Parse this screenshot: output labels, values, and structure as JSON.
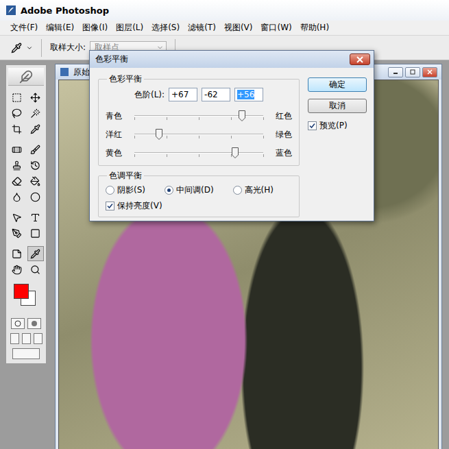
{
  "app": {
    "title": "Adobe Photoshop"
  },
  "menu": [
    "文件(F)",
    "编辑(E)",
    "图像(I)",
    "图层(L)",
    "选择(S)",
    "滤镜(T)",
    "视图(V)",
    "窗口(W)",
    "帮助(H)"
  ],
  "options_bar": {
    "label": "取样大小:",
    "value": "取样点"
  },
  "toolbox": {
    "foreground_color": "#ff0000",
    "background_color": "#ffffff"
  },
  "document": {
    "title": "原始"
  },
  "dialog": {
    "title": "色彩平衡",
    "balance_group": "色彩平衡",
    "levels_label": "色阶(L):",
    "levels": [
      {
        "value": "+67",
        "focused": false
      },
      {
        "value": "-62",
        "focused": false
      },
      {
        "value": "+56",
        "focused": true
      }
    ],
    "sliders": [
      {
        "left": "青色",
        "right": "红色",
        "level": 0.835
      },
      {
        "left": "洋红",
        "right": "绿色",
        "level": 0.19
      },
      {
        "left": "黄色",
        "right": "蓝色",
        "level": 0.78
      }
    ],
    "tone_group": "色调平衡",
    "tones": [
      {
        "label": "阴影(S)",
        "selected": false
      },
      {
        "label": "中间调(D)",
        "selected": true
      },
      {
        "label": "高光(H)",
        "selected": false
      }
    ],
    "preserve": {
      "label": "保持亮度(V)",
      "checked": true
    },
    "buttons": [
      {
        "label": "确定",
        "default": true
      },
      {
        "label": "取消",
        "default": false
      }
    ],
    "preview": {
      "label": "预览(P)",
      "checked": true
    }
  }
}
